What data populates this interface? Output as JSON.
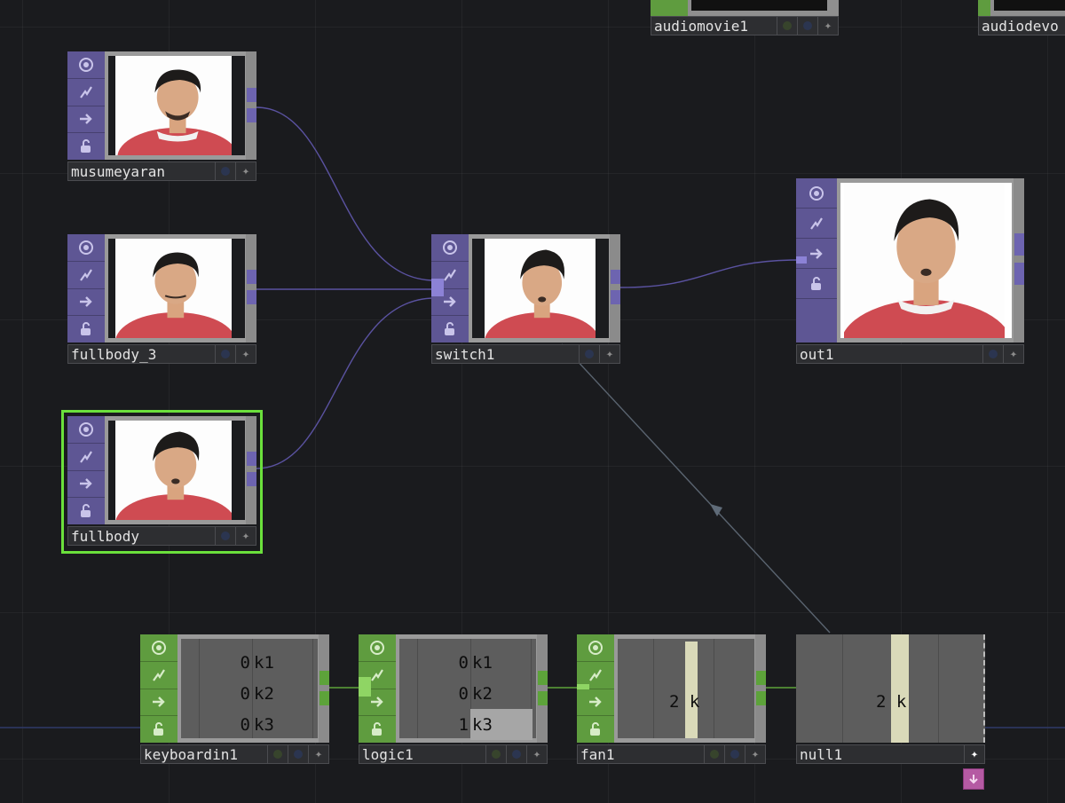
{
  "canvas": {
    "nodes": {
      "audiomovie1": {
        "name": "audiomovie1"
      },
      "audiodevo": {
        "name": "audiodevo"
      },
      "musumeyaran": {
        "name": "musumeyaran"
      },
      "fullbody_3": {
        "name": "fullbody_3"
      },
      "fullbody": {
        "name": "fullbody"
      },
      "switch1": {
        "name": "switch1"
      },
      "out1": {
        "name": "out1"
      },
      "keyboardin1": {
        "name": "keyboardin1",
        "channels": [
          {
            "value": "0",
            "name": "k1"
          },
          {
            "value": "0",
            "name": "k2"
          },
          {
            "value": "0",
            "name": "k3"
          }
        ]
      },
      "logic1": {
        "name": "logic1",
        "channels": [
          {
            "value": "0",
            "name": "k1"
          },
          {
            "value": "0",
            "name": "k2"
          },
          {
            "value": "1",
            "name": "k3"
          }
        ]
      },
      "fan1": {
        "name": "fan1",
        "display": "2 k"
      },
      "null1": {
        "name": "null1",
        "display": "2 k"
      }
    },
    "viewer_flag_icons": [
      "viewer-icon",
      "bypass-icon",
      "display-icon",
      "lock-icon"
    ],
    "colors": {
      "top_family": "#5e5694",
      "chop_family": "#5f9c3f",
      "selected_outline": "#6be03c",
      "wire_top": "#6a5fb8",
      "wire_chop": "#5da33a",
      "background": "#1a1b1e"
    }
  }
}
